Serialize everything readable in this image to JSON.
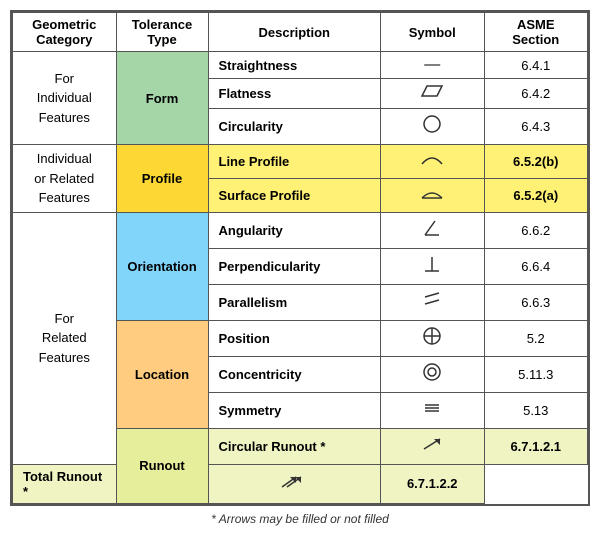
{
  "table": {
    "headers": [
      "Geometric\nCategory",
      "Tolerance\nType",
      "Description",
      "Symbol",
      "ASME\nSection"
    ],
    "rows": [
      {
        "geo_category": "For\nIndividual\nFeatures",
        "geo_rowspan": 3,
        "tol_type": "Form",
        "tol_rowspan": 3,
        "description": "Straightness",
        "symbol": "—",
        "asme": "6.4.1",
        "geo_bg": "white",
        "tol_bg": "form",
        "row_bg": "white"
      },
      {
        "description": "Flatness",
        "symbol": "▱",
        "asme": "6.4.2",
        "row_bg": "white"
      },
      {
        "description": "Circularity",
        "symbol": "○",
        "asme": "6.4.3",
        "row_bg": "white"
      },
      {
        "geo_category": "Individual\nor Related\nFeatures",
        "geo_rowspan": 2,
        "tol_type": "Profile",
        "tol_rowspan": 2,
        "description": "Line Profile",
        "symbol": "⌢",
        "asme": "6.5.2(b)",
        "geo_bg": "white",
        "tol_bg": "profile",
        "row_bg": "yellow"
      },
      {
        "description": "Surface Profile",
        "symbol": "⌣",
        "asme": "6.5.2(a)",
        "row_bg": "yellow"
      },
      {
        "geo_category": "For\nRelated\nFeatures",
        "geo_rowspan": 7,
        "tol_type": "Orientation",
        "tol_rowspan": 3,
        "description": "Angularity",
        "symbol": "∠",
        "asme": "6.6.2",
        "geo_bg": "white",
        "tol_bg": "orientation",
        "row_bg": "white"
      },
      {
        "description": "Perpendicularity",
        "symbol": "⊥",
        "asme": "6.6.4",
        "row_bg": "white"
      },
      {
        "description": "Parallelism",
        "symbol": "//",
        "asme": "6.6.3",
        "row_bg": "white"
      },
      {
        "tol_type": "Location",
        "tol_rowspan": 3,
        "description": "Position",
        "symbol": "⊕",
        "asme": "5.2",
        "tol_bg": "location",
        "row_bg": "white"
      },
      {
        "description": "Concentricity",
        "symbol": "◎",
        "asme": "5.11.3",
        "row_bg": "white"
      },
      {
        "description": "Symmetry",
        "symbol": "≡",
        "asme": "5.13",
        "row_bg": "white"
      },
      {
        "tol_type": "Runout",
        "tol_rowspan": 2,
        "description": "Circular Runout *",
        "symbol": "↗",
        "asme": "6.7.1.2.1",
        "tol_bg": "runout",
        "row_bg": "lime"
      },
      {
        "description": "Total Runout *",
        "symbol": "↗↗",
        "asme": "6.7.1.2.2",
        "row_bg": "lime"
      }
    ],
    "footnote": "* Arrows may be filled or not filled"
  }
}
